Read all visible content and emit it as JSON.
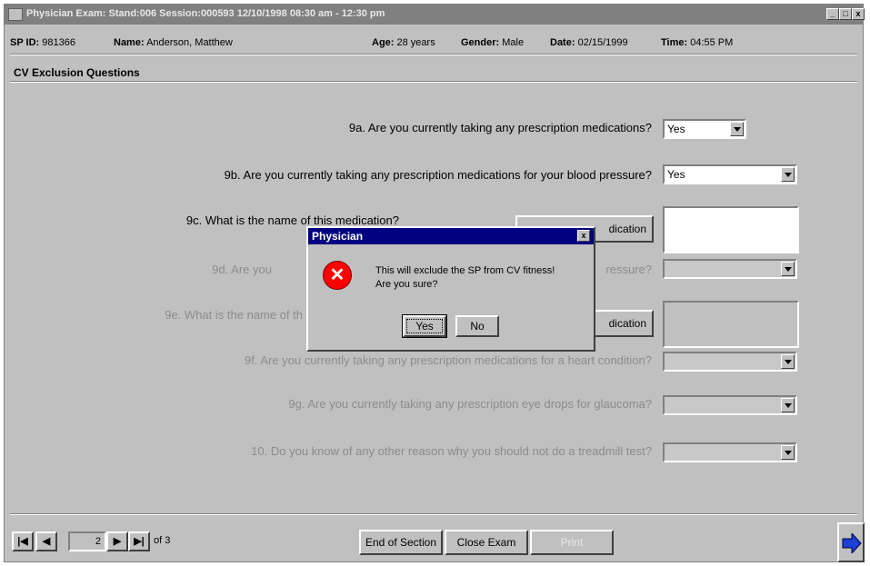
{
  "window": {
    "title": "Physician Exam: Stand:006 Session:000593 12/10/1998 08:30 am - 12:30 pm",
    "minimize": "_",
    "maximize": "□",
    "close": "x"
  },
  "patient": {
    "sp_id_label": "SP ID:",
    "sp_id": "981366",
    "name_label": "Name:",
    "name": "Anderson, Matthew",
    "age_label": "Age:",
    "age": "28 years",
    "gender_label": "Gender:",
    "gender": "Male",
    "date_label": "Date:",
    "date": "02/15/1999",
    "time_label": "Time:",
    "time": "04:55 PM"
  },
  "section_title": "CV Exclusion Questions",
  "questions": [
    {
      "text": "9a. Are you currently taking any prescription medications?",
      "answer": "Yes",
      "enabled": true
    },
    {
      "text": "9b. Are you currently taking any prescription medications for your blood pressure?",
      "answer": "Yes",
      "enabled": true
    },
    {
      "text": "9c. What is the name of this medication?",
      "answer": "",
      "enabled": true
    },
    {
      "text": "9d. Are you",
      "answer": "",
      "enabled": false
    },
    {
      "text": "9e. What is the name of th",
      "answer": "",
      "enabled": false
    },
    {
      "text": "9f. Are you currently taking any prescription medications for a heart condition?",
      "answer": "",
      "enabled": false
    },
    {
      "text": "9g. Are you currently taking any prescription eye drops for glaucoma?",
      "answer": "",
      "enabled": false
    },
    {
      "text": "10. Do you know of any other reason why you should not do a treadmill test?",
      "answer": "",
      "enabled": false
    }
  ],
  "add_med_button_1": "dication",
  "add_med_button_2": "dication",
  "q9d_tail": "ressure?",
  "dialog": {
    "title": "Physician",
    "close": "x",
    "icon": "error-x-icon",
    "message_line1": "This will exclude the SP from CV fitness!",
    "message_line2": "Are you sure?",
    "yes": "Yes",
    "no": "No"
  },
  "nav": {
    "page": "2",
    "of": "of 3",
    "end_of_section": "End of Section",
    "close_exam": "Close Exam",
    "print": "Print"
  }
}
